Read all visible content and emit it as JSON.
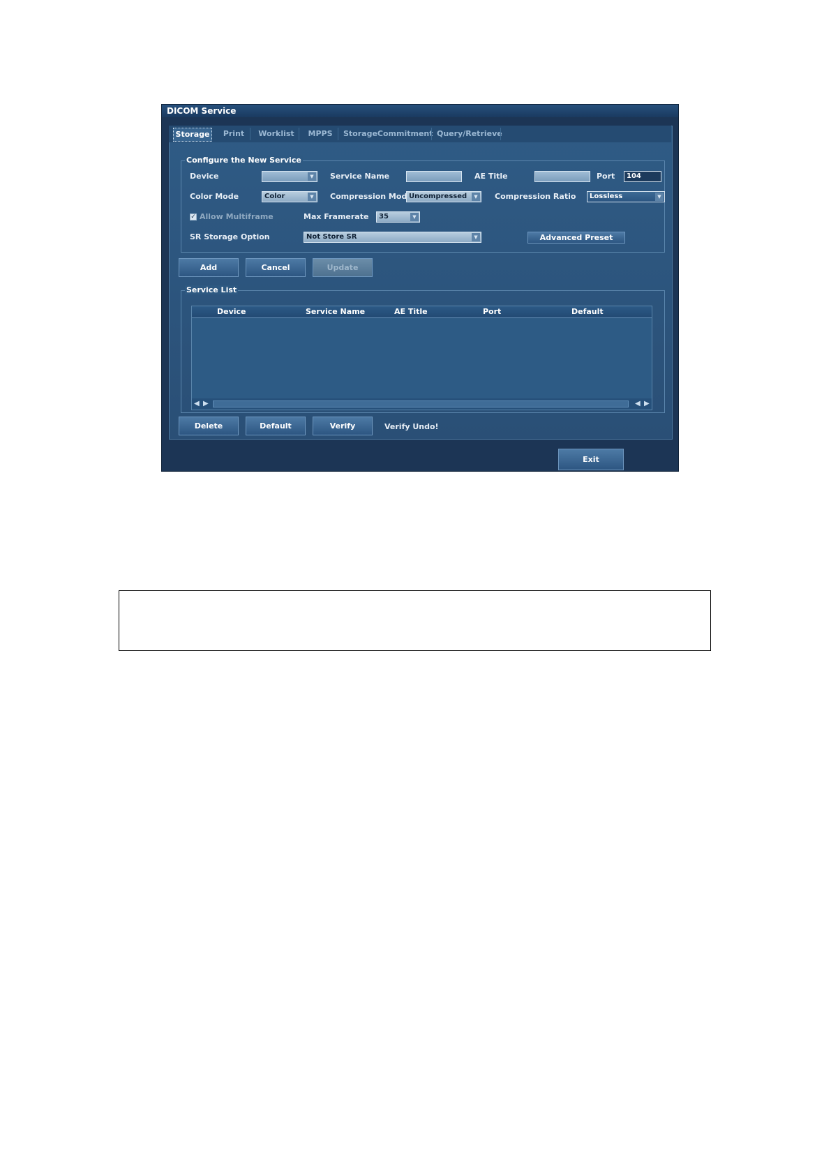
{
  "window": {
    "title": "DICOM Service"
  },
  "tabs": [
    "Storage",
    "Print",
    "Worklist",
    "MPPS",
    "StorageCommitment",
    "Query/Retrieve"
  ],
  "config": {
    "legend": "Configure the New Service",
    "device_label": "Device",
    "device_value": "",
    "service_name_label": "Service Name",
    "service_name_value": "",
    "ae_title_label": "AE Title",
    "ae_title_value": "",
    "port_label": "Port",
    "port_value": "104",
    "color_mode_label": "Color Mode",
    "color_mode_value": "Color",
    "compression_mode_label": "Compression Mode",
    "compression_mode_value": "Uncompressed",
    "compression_ratio_label": "Compression Ratio",
    "compression_ratio_value": "Lossless",
    "allow_multiframe_label": "Allow Multiframe",
    "max_framerate_label": "Max Framerate",
    "max_framerate_value": "35",
    "sr_storage_label": "SR Storage Option",
    "sr_storage_value": "Not Store SR",
    "advanced_preset_label": "Advanced Preset"
  },
  "actions": {
    "add": "Add",
    "cancel": "Cancel",
    "update": "Update"
  },
  "service_list": {
    "legend": "Service List",
    "columns": [
      "Device",
      "Service Name",
      "AE Title",
      "Port",
      "Default"
    ]
  },
  "list_actions": {
    "delete": "Delete",
    "default": "Default",
    "verify": "Verify",
    "status": "Verify Undo!"
  },
  "footer": {
    "exit": "Exit"
  }
}
